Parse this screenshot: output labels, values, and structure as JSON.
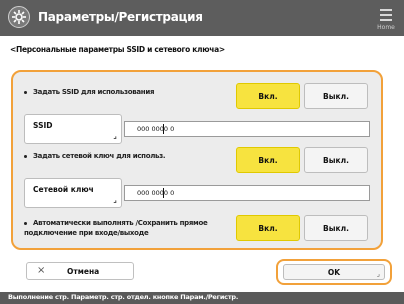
{
  "header": {
    "title": "Параметры/Регистрация",
    "home_label": "Home",
    "icon": "gear-icon"
  },
  "subtitle": "<Персональные параметры SSID и сетевого ключа>",
  "rows": [
    {
      "label": "Задать SSID для использования",
      "on_label": "Вкл.",
      "off_label": "Выкл.",
      "selected": "on"
    },
    {
      "label": "Задать сетевой ключ для использ.",
      "on_label": "Вкл.",
      "off_label": "Выкл.",
      "selected": "on"
    },
    {
      "label": "Автоматически выполнять /Сохранить прямое подключение при входе/выходе",
      "on_label": "Вкл.",
      "off_label": "Выкл.",
      "selected": "on"
    }
  ],
  "ssid": {
    "button_label": "SSID",
    "value": "000 0000 0"
  },
  "network_key": {
    "button_label": "Сетевой ключ",
    "value": "000 0000 0"
  },
  "footer": {
    "cancel_label": "Отмена",
    "ok_label": "OK",
    "status_text": "Выполнение стр. Параметр. стр. отдел. кнопке Парам./Регистр."
  },
  "colors": {
    "accent_orange": "#f2a13a",
    "selected_yellow": "#f7e33f",
    "titlebar_gray": "#5d5d5d"
  }
}
